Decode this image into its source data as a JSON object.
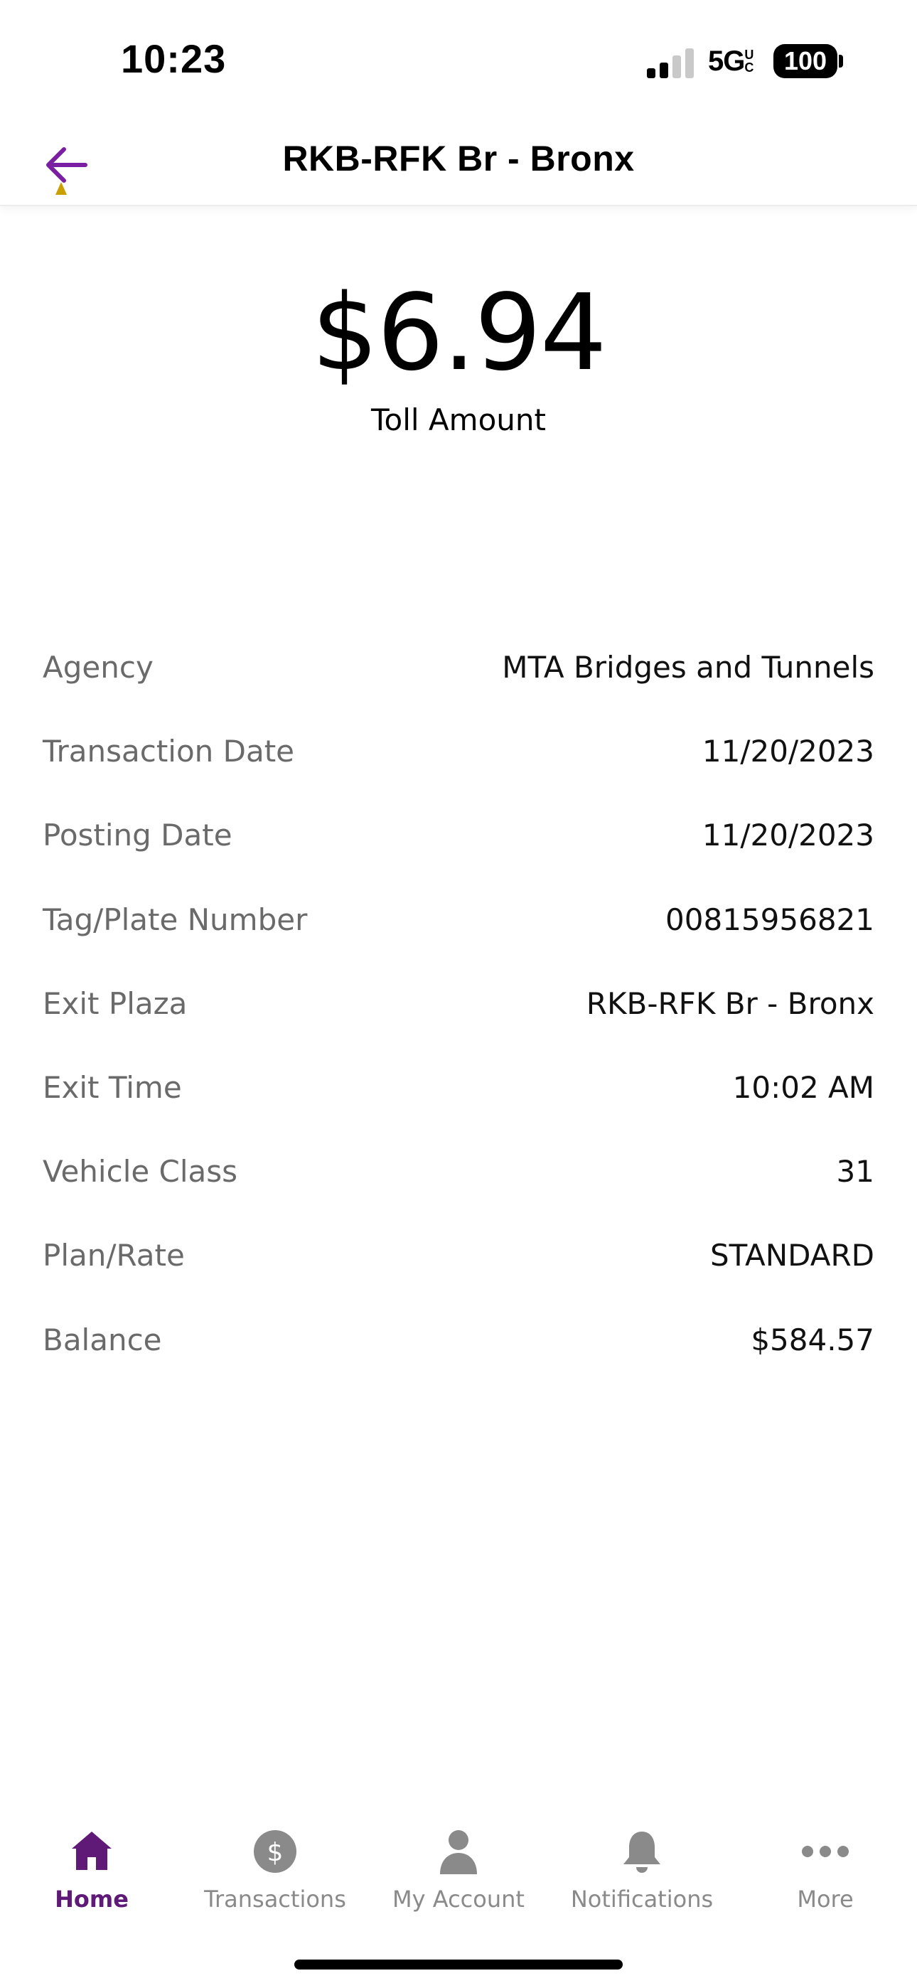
{
  "status_bar": {
    "time": "10:23",
    "network": "5G",
    "network_superscript": "UC",
    "battery": "100",
    "icons": [
      "signal-icon",
      "battery-icon"
    ]
  },
  "header": {
    "title": "RKB-RFK Br - Bronx",
    "back_icon": "arrow-left-icon"
  },
  "toll": {
    "amount": "$6.94",
    "label": "Toll Amount"
  },
  "details": [
    {
      "label": "Agency",
      "value": "MTA Bridges and Tunnels"
    },
    {
      "label": "Transaction Date",
      "value": "11/20/2023"
    },
    {
      "label": "Posting Date",
      "value": "11/20/2023"
    },
    {
      "label": "Tag/Plate Number",
      "value": "00815956821"
    },
    {
      "label": "Exit Plaza",
      "value": "RKB-RFK Br - Bronx"
    },
    {
      "label": "Exit Time",
      "value": "10:02 AM"
    },
    {
      "label": "Vehicle Class",
      "value": "31"
    },
    {
      "label": "Plan/Rate",
      "value": "STANDARD"
    },
    {
      "label": "Balance",
      "value": "$584.57"
    }
  ],
  "tab_bar": {
    "active": "Home",
    "items": [
      {
        "label": "Home",
        "icon": "home-icon"
      },
      {
        "label": "Transactions",
        "icon": "dollar-circle-icon"
      },
      {
        "label": "My Account",
        "icon": "person-icon"
      },
      {
        "label": "Notifications",
        "icon": "bell-icon"
      },
      {
        "label": "More",
        "icon": "more-dots-icon"
      }
    ]
  },
  "colors": {
    "accent": "#5f1a78",
    "back_arrow": "#7b1fa2",
    "back_arrow_accent": "#c8a000",
    "inactive_tab": "#8a8a8a",
    "label_gray": "#6a6a6a"
  }
}
